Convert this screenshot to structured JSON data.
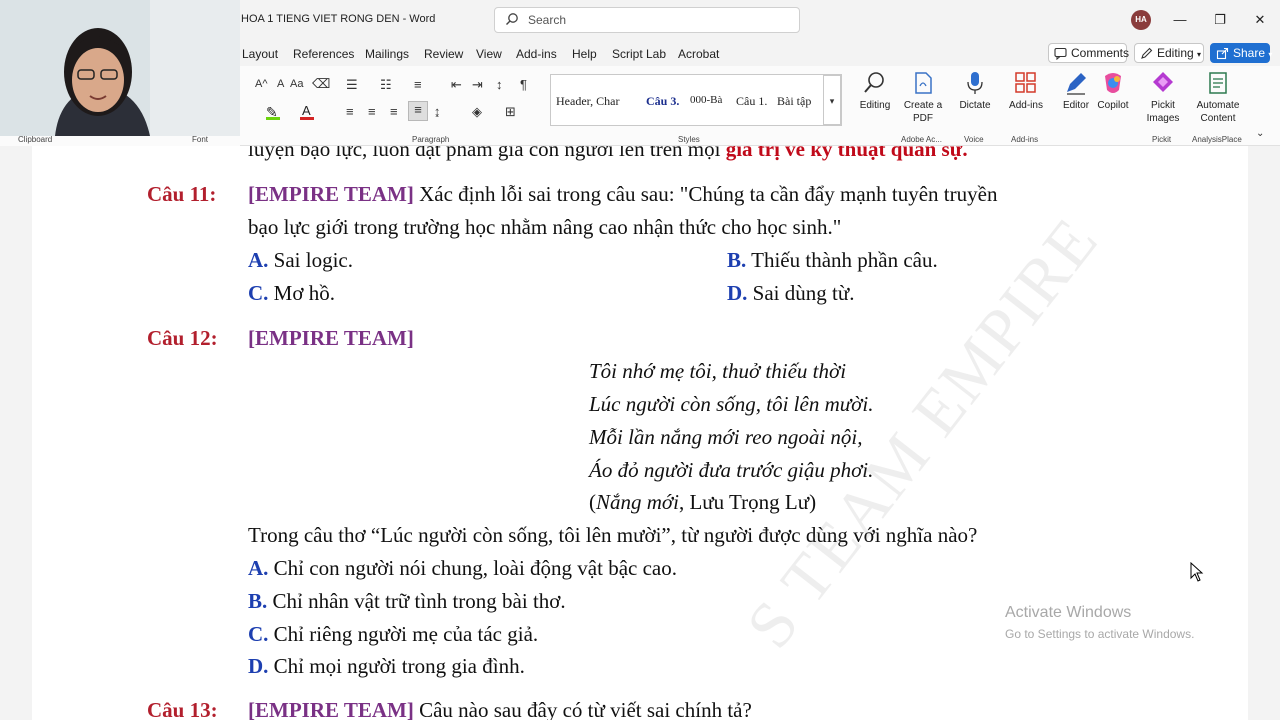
{
  "title_bar": {
    "doc_title": "HOA 1 TIENG VIET RONG DEN  -  Word",
    "search_placeholder": "Search",
    "avatar_initials": "HA"
  },
  "menu": {
    "tabs": [
      "Layout",
      "References",
      "Mailings",
      "Review",
      "View",
      "Add-ins",
      "Help",
      "Script Lab",
      "Acrobat"
    ],
    "comments_label": "Comments",
    "editing_label": "Editing",
    "share_label": "Share"
  },
  "ribbon": {
    "font_size_labels": [
      "A^",
      "A",
      "Aa"
    ],
    "styles": [
      "Header, Char",
      "Câu 3.",
      "000-Bà",
      "Câu 1.",
      "Bài tập"
    ],
    "buttons": {
      "editing": "Editing",
      "create_pdf": "Create a PDF",
      "dictate": "Dictate",
      "add_ins": "Add-ins",
      "editor": "Editor",
      "copilot": "Copilot",
      "pickit": "Pickit Images",
      "automate": "Automate Content"
    },
    "group_labels": {
      "clipboard": "Clipboard",
      "font": "Font",
      "paragraph": "Paragraph",
      "styles": "Styles",
      "adobe": "Adobe Ac...",
      "voice": "Voice",
      "add_ins": "Add-ins",
      "pickit": "Pickit",
      "analysis": "AnalysisPlace"
    }
  },
  "document": {
    "top_line_text": "luyện bạo lực, luôn đặt phẩm giá con người lên trên mọi ",
    "top_line_red": "giá trị về kỹ thuật quân sự.",
    "q11": {
      "num": "Câu 11:",
      "team": "[EMPIRE TEAM]",
      "text1": " Xác định lỗi sai trong câu sau: \"Chúng ta cần đẩy mạnh tuyên truyền",
      "text2": "bạo lực giới trong trường học nhằm nâng cao nhận thức cho học sinh.\"",
      "options": [
        {
          "letter": "A.",
          "text": " Sai logic."
        },
        {
          "letter": "B.",
          "text": " Thiếu thành phần câu."
        },
        {
          "letter": "C.",
          "text": " Mơ hồ."
        },
        {
          "letter": "D.",
          "text": " Sai dùng từ."
        }
      ]
    },
    "q12": {
      "num": "Câu 12:",
      "team": "[EMPIRE TEAM]",
      "poem": [
        "Tôi nhớ mẹ tôi, thuở thiếu thời",
        "Lúc người còn sống, tôi lên mười.",
        "Mỗi lần nắng mới reo ngoài nội,",
        "Áo đỏ người đưa trước giậu phơi."
      ],
      "source_open": "(",
      "source_title": "Nắng mới",
      "source_rest": ", Lưu Trọng Lư)",
      "question": "Trong câu thơ “Lúc người còn sống, tôi lên mười”, từ người được dùng với nghĩa nào?",
      "options": [
        {
          "letter": "A.",
          "text": " Chỉ con người nói chung, loài động vật bậc cao."
        },
        {
          "letter": "B.",
          "text": " Chỉ nhân vật trữ tình trong bài thơ."
        },
        {
          "letter": "C.",
          "text": " Chỉ riêng người mẹ của tác giả."
        },
        {
          "letter": "D.",
          "text": " Chỉ mọi người trong gia đình."
        }
      ]
    },
    "q13": {
      "num": "Câu 13:",
      "team": "[EMPIRE TEAM]",
      "text": " Câu nào sau đây có từ viết sai chính tả?"
    },
    "watermark": "S TEAM EMPIRE"
  },
  "activation": {
    "title": "Activate Windows",
    "subtitle": "Go to Settings to activate Windows."
  },
  "colors": {
    "question_red": "#b21f2d",
    "team_purple": "#7a3185",
    "option_blue": "#1d3fb0",
    "share_blue": "#1f6fd1"
  }
}
